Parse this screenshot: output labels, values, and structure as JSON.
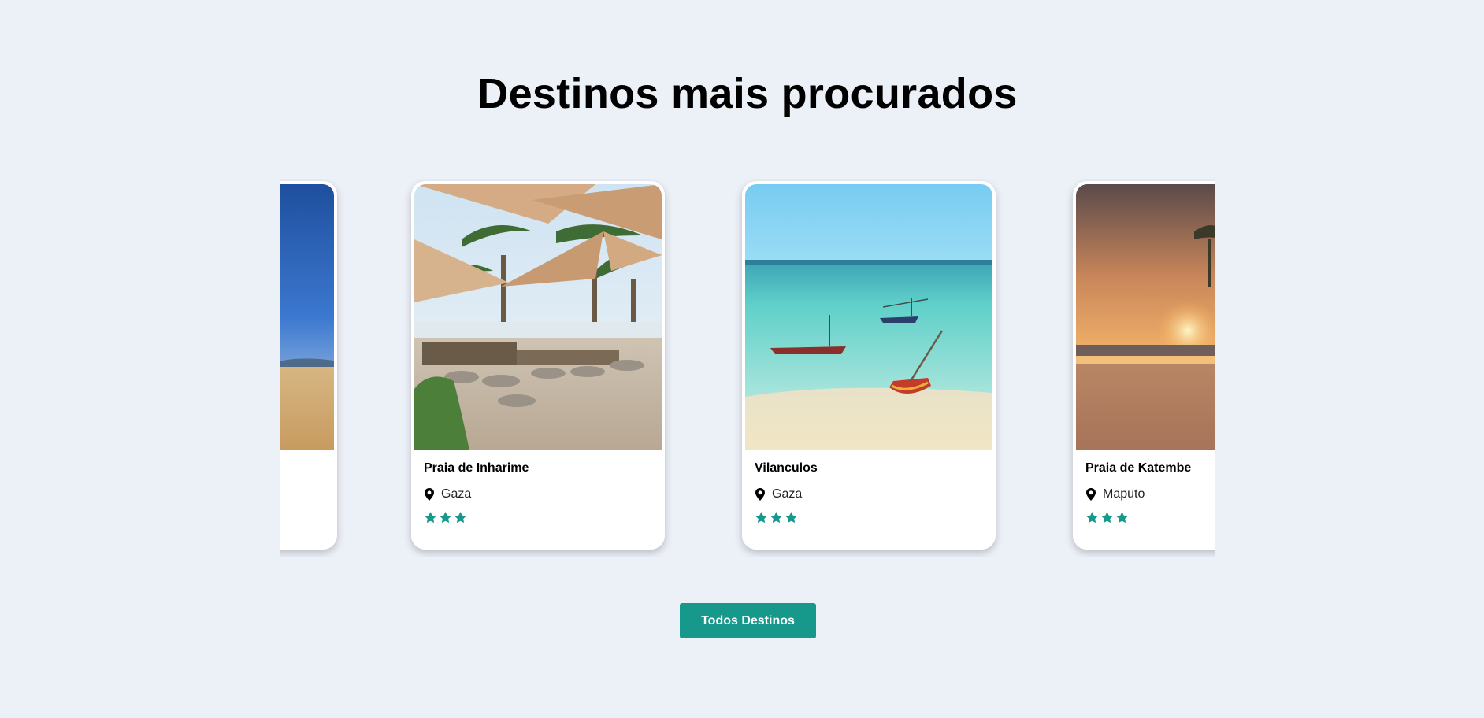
{
  "section": {
    "heading": "Destinos mais procurados"
  },
  "cards": [
    {
      "title": "",
      "location": "",
      "rating": 0,
      "image": "beach-blue-sky"
    },
    {
      "title": "Praia de Inharime",
      "location": "Gaza",
      "rating": 3,
      "image": "beach-lounge-palms"
    },
    {
      "title": "Vilanculos",
      "location": "Gaza",
      "rating": 3,
      "image": "turquoise-sea-boats"
    },
    {
      "title": "Praia de Katembe",
      "location": "Maputo",
      "rating": 3,
      "image": "sunset-beach-palms"
    }
  ],
  "cta": {
    "label": "Todos Destinos"
  },
  "colors": {
    "background": "#ecf0f7",
    "accent": "#16998a",
    "star": "#16998a"
  },
  "icons": {
    "location": "location-pin-icon",
    "rating": "star-icon"
  }
}
